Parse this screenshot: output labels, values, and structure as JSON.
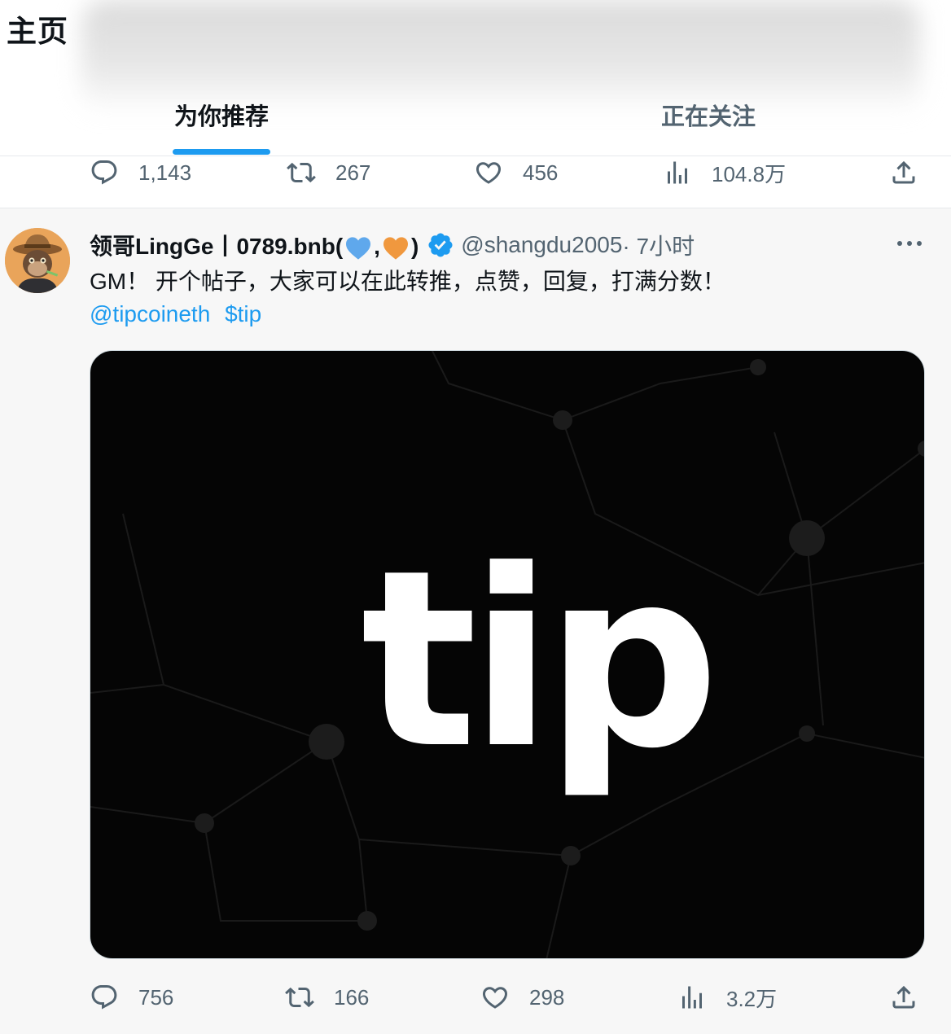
{
  "header": {
    "title": "主页",
    "tabs": [
      {
        "label": "为你推荐",
        "active": true
      },
      {
        "label": "正在关注",
        "active": false
      }
    ]
  },
  "prev_post": {
    "replies": "1,143",
    "retweets": "267",
    "likes": "456",
    "views": "104.8万"
  },
  "post": {
    "display_name": "领哥LingGe丨0789.bnb(",
    "name_sep": ",",
    "name_close": ")",
    "handle": "@shangdu2005",
    "time": " · 7小时",
    "text_line1": "GM！ 开个帖子，大家可以在此转推，点赞，回复，打满分数！",
    "mention": "@tipcoineth",
    "cashtag": "$tip",
    "media_text": "tip",
    "replies": "756",
    "retweets": "166",
    "likes": "298",
    "views": "3.2万"
  },
  "colors": {
    "accent": "#1d9bf0",
    "secondary_text": "#536471",
    "heart_blue": "#5fa8ec",
    "heart_orange": "#f0983e"
  },
  "icons": [
    "reply-icon",
    "retweet-icon",
    "like-icon",
    "views-icon",
    "share-icon",
    "verified-badge-icon",
    "more-icon",
    "blue-heart-icon",
    "orange-heart-icon"
  ]
}
